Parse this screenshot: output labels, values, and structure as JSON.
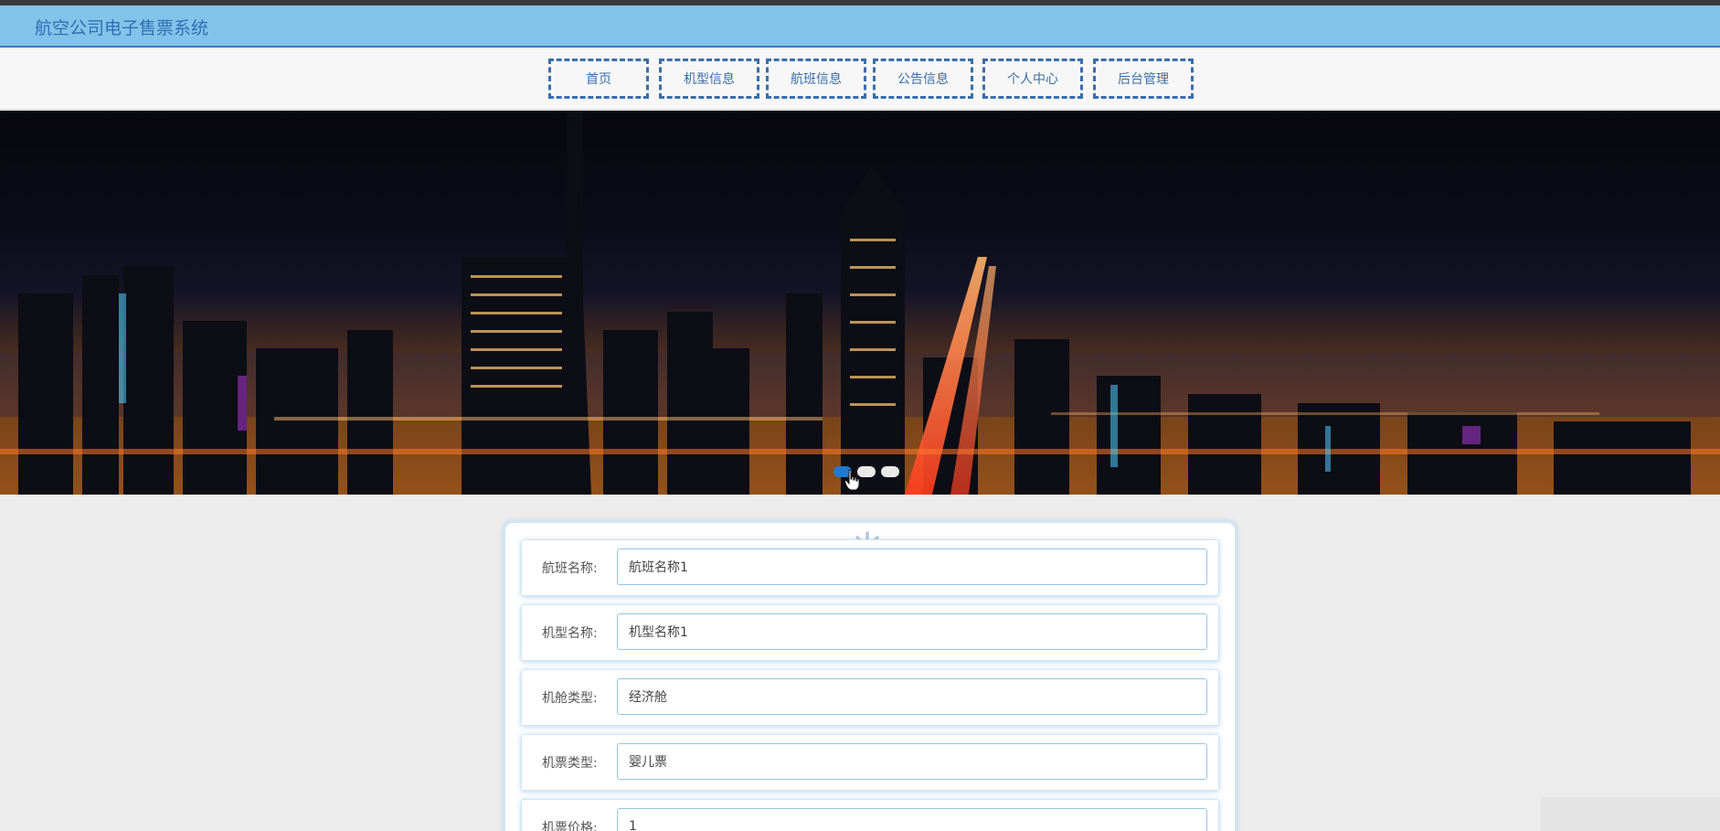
{
  "app": {
    "title": "航空公司电子售票系统"
  },
  "nav": {
    "items": [
      {
        "label": "首页"
      },
      {
        "label": "机型信息"
      },
      {
        "label": "航班信息"
      },
      {
        "label": "公告信息"
      },
      {
        "label": "个人中心"
      },
      {
        "label": "后台管理"
      }
    ]
  },
  "banner": {
    "slides": 3,
    "active_slide": 1
  },
  "form": {
    "fields": [
      {
        "label": "航班名称:",
        "value": "航班名称1"
      },
      {
        "label": "机型名称:",
        "value": "机型名称1"
      },
      {
        "label": "机舱类型:",
        "value": "经济舱"
      },
      {
        "label": "机票类型:",
        "value": "婴儿票"
      },
      {
        "label": "机票价格:",
        "value": "1"
      }
    ]
  },
  "colors": {
    "titlebar": "#82c3ea",
    "title_text": "#2f6fb0",
    "nav_border": "#3b6ea8",
    "active_dot": "#1f7bd1",
    "input_border": "#94c6e6"
  }
}
